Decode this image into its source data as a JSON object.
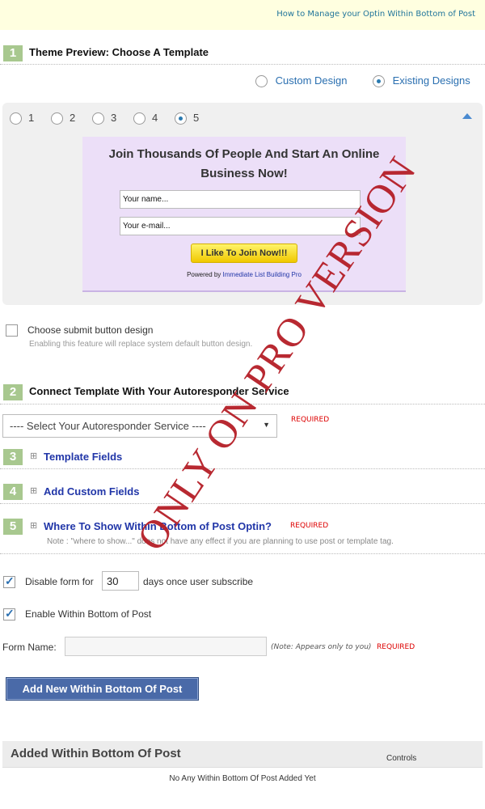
{
  "top_link": "How to Manage your Optin Within Bottom of Post",
  "step1": {
    "num": "1",
    "title": "Theme Preview: Choose A Template",
    "design_options": [
      {
        "label": "Custom Design",
        "checked": false
      },
      {
        "label": "Existing Designs",
        "checked": true
      }
    ],
    "templates": [
      {
        "label": "1",
        "checked": false
      },
      {
        "label": "2",
        "checked": false
      },
      {
        "label": "3",
        "checked": false
      },
      {
        "label": "4",
        "checked": false
      },
      {
        "label": "5",
        "checked": true
      }
    ]
  },
  "optin_preview": {
    "headline": "Join Thousands Of People And Start An Online Business Now!",
    "name_value": "Your name...",
    "email_value": "Your e-mail...",
    "button_label": "I Like To Join Now!!!",
    "powered_by": "Powered by",
    "powered_link": "Immediate List Building Pro"
  },
  "submit_design": {
    "label": "Choose submit button design",
    "note": "Enabling this feature will replace system default button design.",
    "checked": false
  },
  "step2": {
    "num": "2",
    "title": "Connect Template With Your Autoresponder Service",
    "select_value": "---- Select Your Autoresponder Service ----",
    "required": "REQUIRED"
  },
  "step3": {
    "num": "3",
    "title": "Template Fields"
  },
  "step4": {
    "num": "4",
    "title": "Add Custom Fields"
  },
  "step5": {
    "num": "5",
    "title": "Where To Show Within Bottom of Post Optin?",
    "required": "REQUIRED",
    "note": "Note : \"where to show...\" does not have any effect if you are planning to use post or template tag."
  },
  "disable_form": {
    "label_before": "Disable form for",
    "days": "30",
    "label_after": "days once user subscribe",
    "checked": true
  },
  "enable_bottom": {
    "label": "Enable Within Bottom of Post",
    "checked": true
  },
  "form_name": {
    "label": "Form Name:",
    "value": "",
    "note": "(Note: Appears only to you)",
    "required": "REQUIRED"
  },
  "add_button": "Add New Within Bottom Of Post",
  "added_section": {
    "title": "Added Within Bottom Of Post",
    "controls": "Controls",
    "empty": "No Any Within Bottom Of Post Added Yet"
  },
  "watermark": "ONLY ON PRO VERSION",
  "colors": {
    "accent": "#2a6fb0",
    "step_badge": "#a8c88f",
    "required": "#dd0000",
    "watermark": "#b51e27"
  }
}
